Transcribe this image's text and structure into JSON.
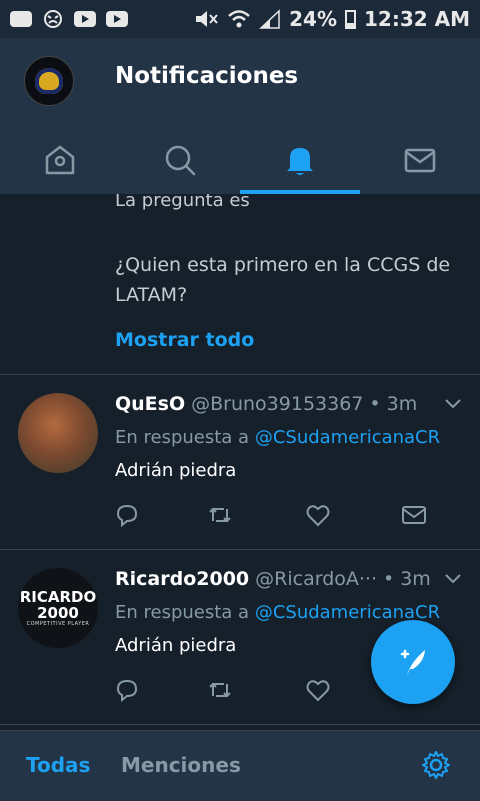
{
  "status_bar": {
    "battery": "24%",
    "time": "12:32 AM"
  },
  "header": {
    "title": "Notificaciones",
    "tabs": [
      {
        "icon": "home-icon"
      },
      {
        "icon": "search-icon"
      },
      {
        "icon": "bell-icon",
        "active": true
      },
      {
        "icon": "mail-icon"
      }
    ]
  },
  "feed": {
    "previous": {
      "line1": "La pregunta es",
      "line2": "¿Quien esta primero en la CCGS de LATAM?",
      "show_all": "Mostrar todo"
    },
    "tweets": [
      {
        "name": "QuEsO",
        "handle": "@Bruno39153367",
        "dot": "•",
        "time": "3m",
        "reply_prefix": "En respuesta a",
        "reply_to": "@CSudamericanaCR",
        "text": "Adrián piedra"
      },
      {
        "name": "Ricardo2000",
        "handle": "@RicardoA···",
        "dot": "•",
        "time": "3m",
        "reply_prefix": "En respuesta a",
        "reply_to": "@CSudamericanaCR",
        "text": "Adrián piedra",
        "avatar_text": "RICARDO",
        "avatar_number": "2000",
        "avatar_subtext": "COMPETITIVE PLAYER"
      }
    ]
  },
  "bottom_bar": {
    "all_label": "Todas",
    "mentions_label": "Menciones"
  },
  "colors": {
    "accent": "#1da1f2",
    "background": "#15202b",
    "header": "#243447"
  }
}
